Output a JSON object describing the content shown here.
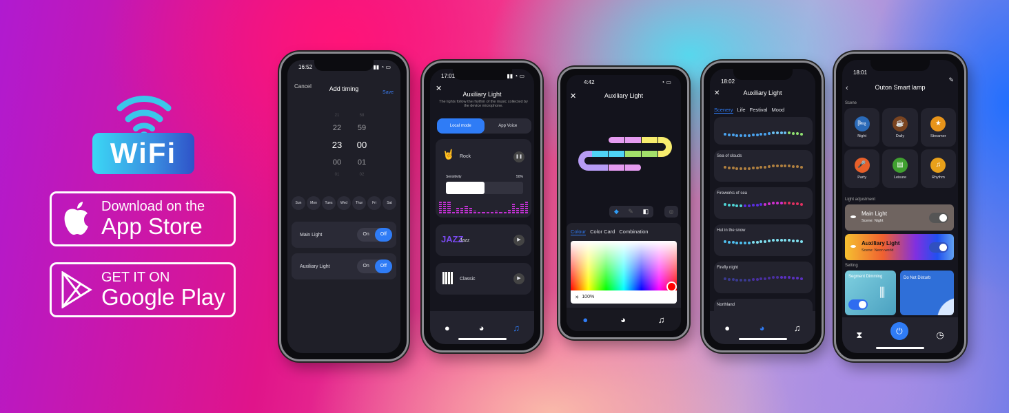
{
  "promo": {
    "wifi_label": "WiFi",
    "app_store": {
      "small": "Download on the",
      "big": "App Store"
    },
    "google_play": {
      "small": "GET IT ON",
      "big": "Google Play"
    }
  },
  "phone1": {
    "time": "16:52",
    "cancel": "Cancel",
    "title": "Add timing",
    "save": "Save",
    "hours": [
      "21",
      "22",
      "23",
      "00",
      "01"
    ],
    "minutes": [
      "58",
      "59",
      "00",
      "01",
      "02"
    ],
    "days": [
      "Sun",
      "Mon",
      "Tues",
      "Wed",
      "Thur",
      "Fri",
      "Sat"
    ],
    "rows": [
      {
        "label": "Main Light",
        "on": "On",
        "off": "Off"
      },
      {
        "label": "Auxiliary Light",
        "on": "On",
        "off": "Off"
      }
    ]
  },
  "phone2": {
    "time": "17:01",
    "title": "Auxiliary Light",
    "desc": "The lights follow the rhythm of the music collected by the device microphone.",
    "tabs": [
      "Local mode",
      "App Voice"
    ],
    "sensitivity_label": "Sensitivity",
    "sensitivity": "50%",
    "sensitivity_value": 0.5,
    "modes": [
      {
        "name": "Rock",
        "state": "pause"
      },
      {
        "name": "Jazz",
        "state": "play",
        "logo": "JAZZ"
      },
      {
        "name": "Classic",
        "state": "play"
      }
    ]
  },
  "phone3": {
    "time": "4:42",
    "title": "Auxiliary Light",
    "tabs": [
      "Colour",
      "Color Card",
      "Combination"
    ],
    "brightness": "100%",
    "selected_color": "#ff0000",
    "segments": {
      "top": [
        "#e59bf0",
        "#e59bf0",
        "#f7ec6e"
      ],
      "middle": [
        "#4fd3f5",
        "#4fd3f5",
        "#a3e06a",
        "#a3e06a"
      ],
      "bottom": [
        "#b79cf5",
        "#e59bf0",
        "#e59bf0"
      ],
      "right_curve": "#f7ec6e",
      "left_curve": "#b79cf5"
    }
  },
  "phone4": {
    "time": "18:02",
    "title": "Auxiliary Light",
    "tabs": [
      "Scenery",
      "Life",
      "Festival",
      "Mood"
    ],
    "scenes": [
      {
        "name": "",
        "colors": [
          "#4aa3ef",
          "#4aa3ef",
          "#4aa3ef",
          "#6cc0f0",
          "#90e070"
        ]
      },
      {
        "name": "Sea of clouds",
        "colors": [
          "#b08040",
          "#b08040",
          "#b08040"
        ]
      },
      {
        "name": "Fireworks of sea",
        "colors": [
          "#4fd3d5",
          "#5a2ee0",
          "#d030d0",
          "#e03060"
        ]
      },
      {
        "name": "Hut in the snow",
        "colors": [
          "#4fc0ef",
          "#80e0f0",
          "#80e0f0"
        ]
      },
      {
        "name": "Firefly night",
        "colors": [
          "#3a3a90",
          "#4a2fa0",
          "#5a30c0"
        ]
      },
      {
        "name": "Northland",
        "colors": []
      }
    ]
  },
  "phone5": {
    "time": "18:01",
    "title": "Outon Smart lamp",
    "scene_label": "Scene",
    "scenes": [
      {
        "name": "Night",
        "color": "#2a6ab8",
        "icon": "🛏"
      },
      {
        "name": "Daily",
        "color": "#7a4420",
        "icon": "☕"
      },
      {
        "name": "Streamer",
        "color": "#e8941a",
        "icon": "★"
      },
      {
        "name": "Party",
        "color": "#e8602a",
        "icon": "🎤"
      },
      {
        "name": "Leisure",
        "color": "#40a030",
        "icon": "▤"
      },
      {
        "name": "Rhythm",
        "color": "#e8a01a",
        "icon": "♫"
      }
    ],
    "adjust_label": "Light adjustment",
    "lights": [
      {
        "name": "Main Light",
        "scene": "Scene: Night",
        "on": true
      },
      {
        "name": "Auxiliary Light",
        "scene": "Scene: Neon world",
        "on": true
      }
    ],
    "setting_label": "Setting",
    "settings": [
      {
        "name": "Segment Dimming",
        "on": true
      },
      {
        "name": "Do Not Disturb",
        "on": false
      }
    ]
  }
}
